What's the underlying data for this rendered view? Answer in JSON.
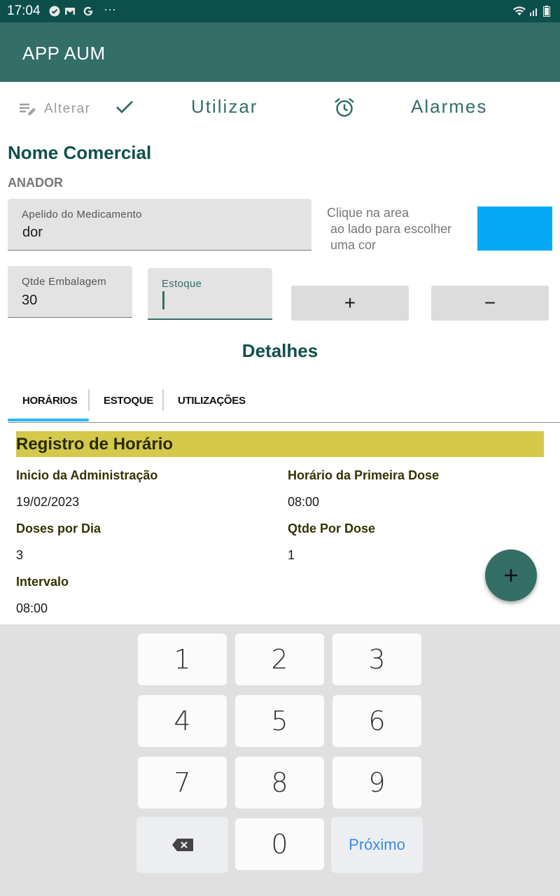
{
  "status_bar": {
    "time": "17:04",
    "more": "···"
  },
  "app_bar": {
    "title": "APP AUM"
  },
  "toolbar": {
    "alterar_label": "Alterar",
    "utilizar_label": "Utilizar",
    "alarmes_label": "Alarmes"
  },
  "medicine": {
    "section_title": "Nome Comercial",
    "commercial_name": "ANADOR",
    "nickname_label": "Apelido do Medicamento",
    "nickname_value": "dor",
    "color_hint_line1": "Clique na area",
    "color_hint_line2": "ao lado para escolher",
    "color_hint_line3": "uma cor",
    "selected_color": "#03a9f4",
    "qty_label": "Qtde Embalagem",
    "qty_value": "30",
    "stock_label": "Estoque",
    "stock_value": "",
    "plus_label": "+",
    "minus_label": "−"
  },
  "details": {
    "title": "Detalhes",
    "tabs": [
      {
        "label": "HORÁRIOS",
        "active": true
      },
      {
        "label": "ESTOQUE",
        "active": false
      },
      {
        "label": "UTILIZAÇÕES",
        "active": false
      }
    ],
    "card_title": "Registro de Horário",
    "start_label": "Inicio da Administração",
    "start_value": "19/02/2023",
    "first_dose_label": "Horário da Primeira Dose",
    "first_dose_value": "08:00",
    "doses_label": "Doses por Dia",
    "doses_value": "3",
    "qty_dose_label": "Qtde Por Dose",
    "qty_dose_value": "1",
    "interval_label": "Intervalo",
    "interval_value": "08:00"
  },
  "fab": {
    "icon": "plus-icon"
  },
  "keyboard": {
    "keys": [
      "1",
      "2",
      "3",
      "4",
      "5",
      "6",
      "7",
      "8",
      "9",
      "0"
    ],
    "next_label": "Próximo"
  },
  "colors": {
    "primary": "#336e67",
    "status_bar": "#0d4f4b",
    "accent_tab": "#29b6f6",
    "card_header": "#d4c94a"
  }
}
